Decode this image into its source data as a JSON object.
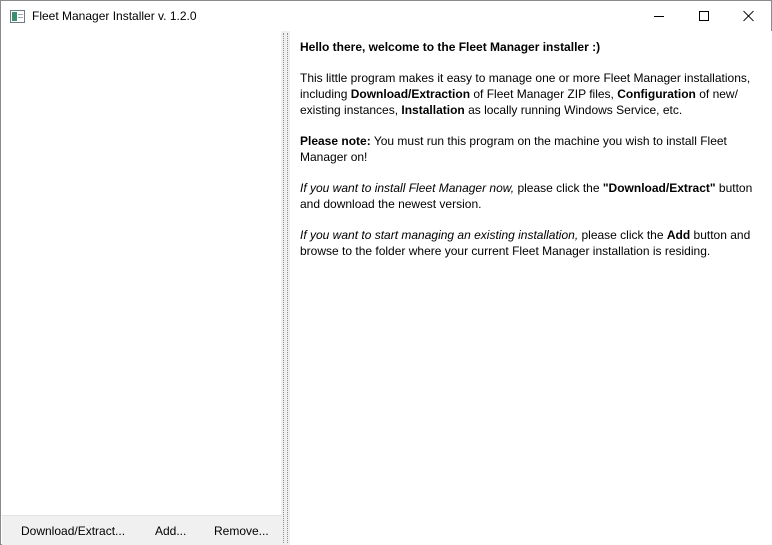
{
  "window": {
    "title": "Fleet Manager Installer v. 1.2.0",
    "controls": [
      "minimize",
      "maximize",
      "close"
    ]
  },
  "toolbar": {
    "download_label": "Download/Extract...",
    "add_label": "Add...",
    "remove_label": "Remove..."
  },
  "welcome": {
    "heading": "Hello there, welcome to the Fleet Manager installer :)",
    "intro": {
      "t1": "This little program makes it easy to manage one or more Fleet Manager installations, including ",
      "b1": "Download/Extraction",
      "t2": " of Fleet Manager ZIP files, ",
      "b2": "Configuration",
      "t3": " of new/ existing instances, ",
      "b3": "Installation",
      "t4": " as locally running Windows Service, etc."
    },
    "note": {
      "b1": "Please note:",
      "t1": " You must run this program on the machine you wish to install Fleet Manager on!"
    },
    "install": {
      "i1": "If you want to install Fleet Manager now,",
      "t1": " please click the ",
      "b1": "\"Download/Extract\"",
      "t2": " button and download the newest version."
    },
    "existing": {
      "i1": "If you want to start managing an existing installation,",
      "t1": " please click the ",
      "b1": "Add",
      "t2": " button and browse to the folder where your current Fleet Manager installation is residing."
    }
  }
}
